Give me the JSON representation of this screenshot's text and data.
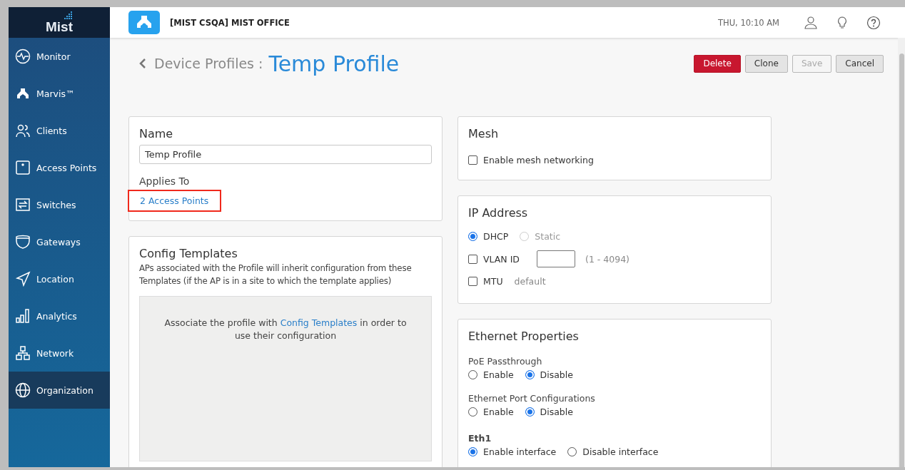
{
  "sidebar": {
    "logo": "Mist",
    "items": [
      {
        "label": "Monitor",
        "selected": false
      },
      {
        "label": "Marvis™",
        "selected": false
      },
      {
        "label": "Clients",
        "selected": false
      },
      {
        "label": "Access Points",
        "selected": false
      },
      {
        "label": "Switches",
        "selected": false
      },
      {
        "label": "Gateways",
        "selected": false
      },
      {
        "label": "Location",
        "selected": false
      },
      {
        "label": "Analytics",
        "selected": false
      },
      {
        "label": "Network",
        "selected": false
      },
      {
        "label": "Organization",
        "selected": true
      }
    ]
  },
  "header": {
    "site": "[MIST CSQA] MIST OFFICE",
    "time": "THU, 10:10 AM"
  },
  "page": {
    "breadcrumb": "Device Profiles :",
    "title": "Temp Profile",
    "buttons": [
      {
        "label": "Delete",
        "kind": "danger",
        "disabled": false
      },
      {
        "label": "Clone",
        "kind": "default",
        "disabled": false
      },
      {
        "label": "Save",
        "kind": "default",
        "disabled": true
      },
      {
        "label": "Cancel",
        "kind": "default",
        "disabled": false
      }
    ]
  },
  "name_card": {
    "title": "Name",
    "value": "Temp Profile",
    "applies_label": "Applies To",
    "applies_link": "2 Access Points",
    "highlighted": true
  },
  "config_templates": {
    "title": "Config Templates",
    "description": "APs associated with the Profile will inherit configuration from these Templates (if the AP is in a site to which the template applies)",
    "message_before": "Associate the profile with",
    "message_link": "Config Templates",
    "message_after": "in order to use their configuration"
  },
  "mesh": {
    "title": "Mesh",
    "checkbox": {
      "label": "Enable mesh networking",
      "checked": false
    }
  },
  "ip_address": {
    "title": "IP Address",
    "modes": [
      {
        "label": "DHCP",
        "selected": true,
        "disabled": false
      },
      {
        "label": "Static",
        "selected": false,
        "disabled": true
      }
    ],
    "vlan": {
      "label": "VLAN ID",
      "checked": false,
      "hint": "(1 - 4094)"
    },
    "mtu": {
      "label": "MTU",
      "checked": false,
      "value": "default"
    }
  },
  "ethernet": {
    "title": "Ethernet Properties",
    "groups": [
      {
        "label": "PoE Passthrough",
        "bold": false,
        "options": [
          {
            "label": "Enable",
            "selected": false
          },
          {
            "label": "Disable",
            "selected": true
          }
        ]
      },
      {
        "label": "Ethernet Port Configurations",
        "bold": false,
        "options": [
          {
            "label": "Enable",
            "selected": false
          },
          {
            "label": "Disable",
            "selected": true
          }
        ]
      },
      {
        "label": "Eth1",
        "bold": true,
        "options": [
          {
            "label": "Enable interface",
            "selected": true
          },
          {
            "label": "Disable interface",
            "selected": false
          }
        ]
      }
    ]
  }
}
